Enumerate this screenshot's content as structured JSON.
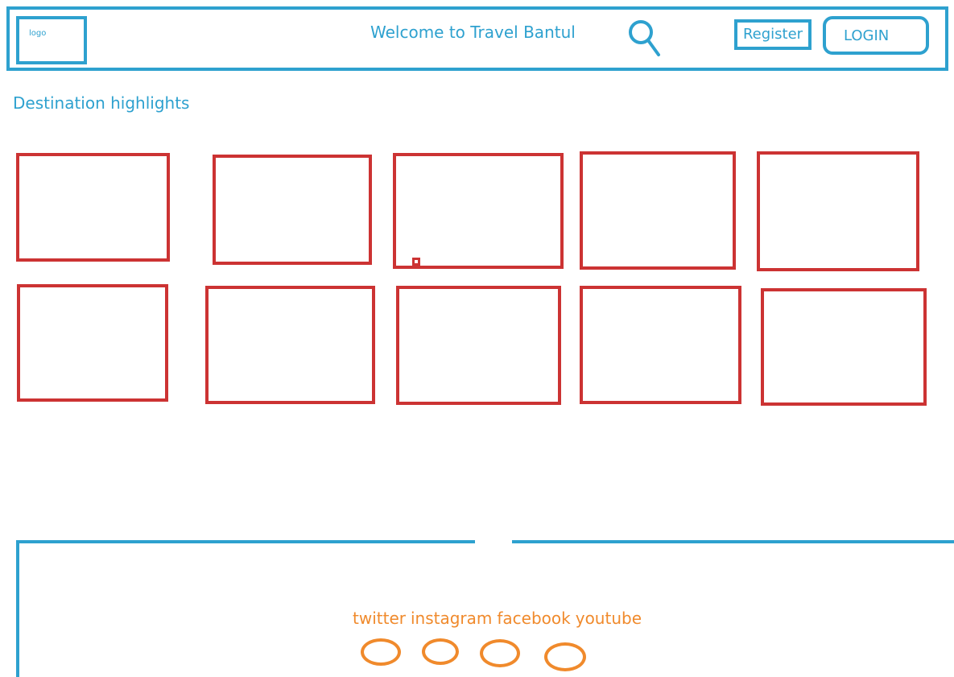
{
  "header": {
    "logo_label": "logo",
    "welcome_text": "Welcome to Travel Bantul",
    "search_icon": "search-icon",
    "register_label": "Register",
    "login_label": "LOGIN"
  },
  "main": {
    "section_title": "Destination highlights",
    "grid": {
      "rows": 2,
      "columns": 5,
      "cards": 10
    }
  },
  "footer": {
    "social": [
      "twitter",
      "instagram",
      "facebook",
      "youtube"
    ],
    "social_icons": [
      "twitter-icon",
      "instagram-icon",
      "facebook-icon",
      "youtube-icon"
    ]
  },
  "colors": {
    "primary_blue": "#2ea1cf",
    "card_red": "#cc3333",
    "social_orange": "#f08a2c"
  }
}
